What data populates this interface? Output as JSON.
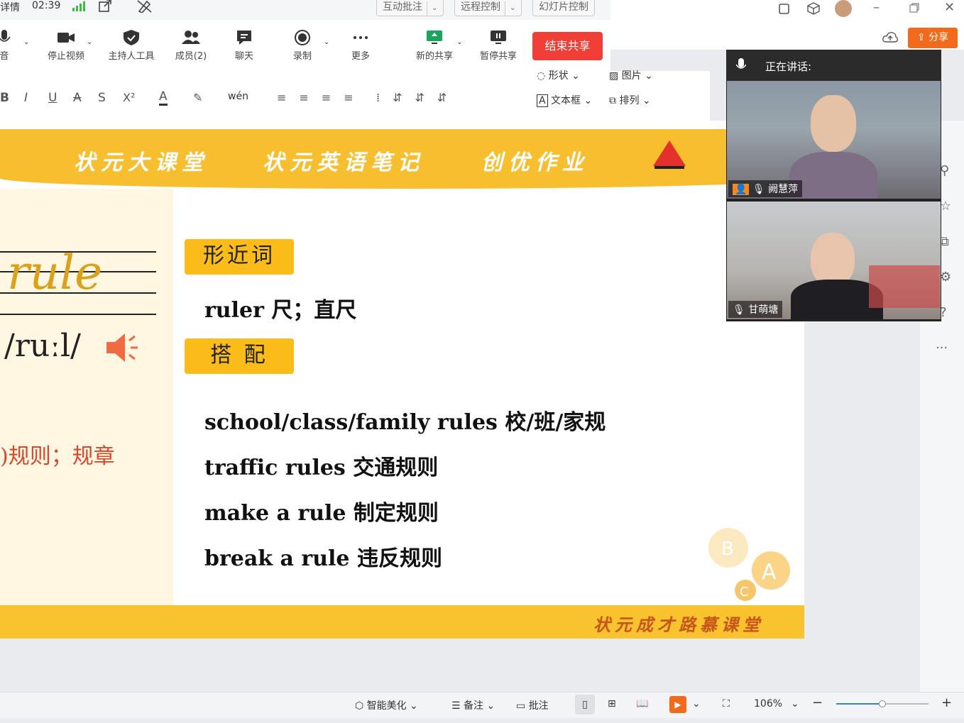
{
  "meeting": {
    "details_label": "详情",
    "time": "02:39",
    "top_buttons": [
      "互动批注",
      "远程控制",
      "幻灯片控制"
    ],
    "tools": [
      {
        "label": "音",
        "icon": "microphone-icon"
      },
      {
        "label": "停止视频",
        "icon": "video-camera-icon"
      },
      {
        "label": "主持人工具",
        "icon": "shield-icon"
      },
      {
        "label": "成员(2)",
        "icon": "members-icon"
      },
      {
        "label": "聊天",
        "icon": "chat-icon"
      },
      {
        "label": "录制",
        "icon": "record-icon"
      },
      {
        "label": "更多",
        "icon": "more-icon"
      },
      {
        "label": "新的共享",
        "icon": "share-screen-icon"
      },
      {
        "label": "暂停共享",
        "icon": "pause-share-icon"
      }
    ],
    "end_share_label": "结束共享",
    "speaking_label": "正在讲话:",
    "participants": [
      {
        "name": "阙慧萍"
      },
      {
        "name": "甘萌塘"
      }
    ]
  },
  "wps": {
    "share_label": "分享",
    "ribbon": {
      "shape_label": "形状",
      "image_label": "图片",
      "textbox_label": "文本框",
      "arrange_label": "排列"
    }
  },
  "slide": {
    "banner": [
      "状元大课堂",
      "状元英语笔记",
      "创优作业"
    ],
    "word": "rule",
    "phonetic": "/ruːl/",
    "meaning": ")规则；规章",
    "tag_similar": "形近词",
    "similar_line": "ruler 尺；直尺",
    "tag_collocation": "搭 配",
    "collocations": [
      "school/class/family rules 校/班/家规",
      "traffic rules 交通规则",
      "make a rule 制定规则",
      "break a rule 违反规则"
    ],
    "footer_text": "状元成才路慕课堂"
  },
  "statusbar": {
    "beautify_label": "智能美化",
    "notes_label": "备注",
    "annotate_label": "批注",
    "zoom": "106%"
  }
}
